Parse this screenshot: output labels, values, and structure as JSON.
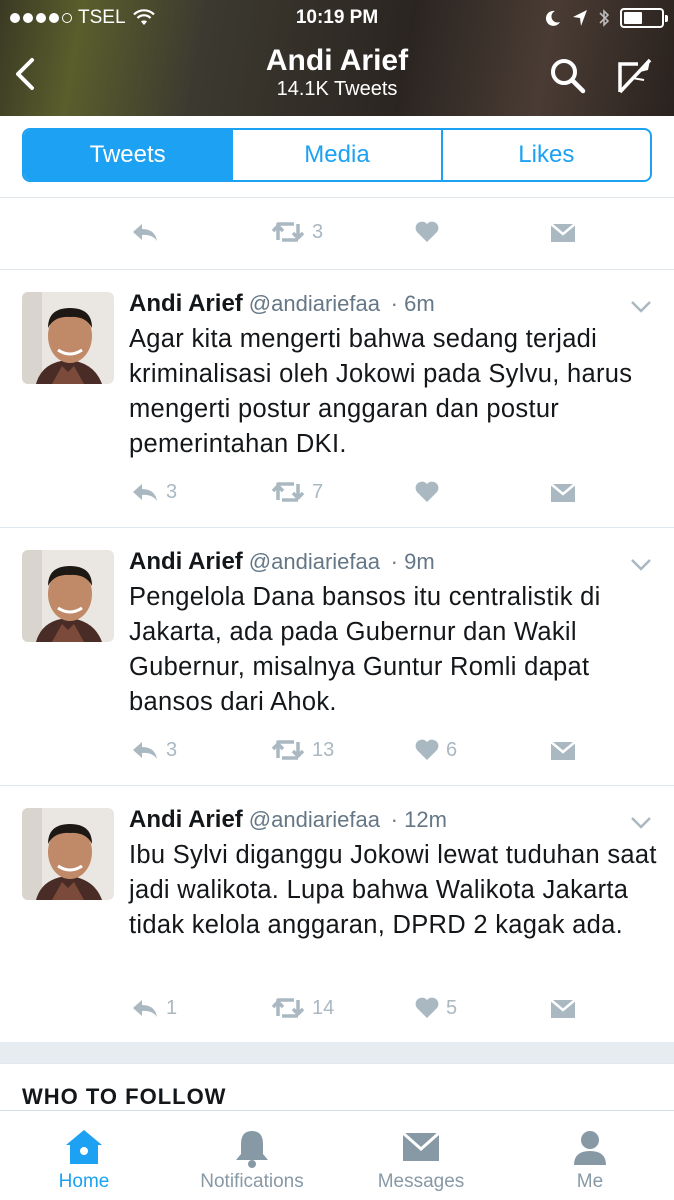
{
  "status_bar": {
    "carrier": "TSEL",
    "time": "10:19 PM"
  },
  "header": {
    "title": "Andi Arief",
    "subtitle": "14.1K Tweets"
  },
  "tabs": [
    {
      "label": "Tweets",
      "active": true
    },
    {
      "label": "Media",
      "active": false
    },
    {
      "label": "Likes",
      "active": false
    }
  ],
  "partial_tweet": {
    "reply_count": "",
    "retweet_count": "3",
    "like_count": ""
  },
  "tweets": [
    {
      "name": "Andi Arief",
      "handle": "@andiariefaa",
      "time": "· 6m",
      "text": "Agar kita mengerti bahwa sedang terjadi kriminalisasi oleh Jokowi pada Sylvu, harus mengerti postur anggaran dan postur pemerintahan DKI.",
      "reply_count": "3",
      "retweet_count": "7",
      "like_count": ""
    },
    {
      "name": "Andi Arief",
      "handle": "@andiariefaa",
      "time": "· 9m",
      "text": "Pengelola Dana bansos itu centralistik di Jakarta, ada pada Gubernur dan Wakil Gubernur, misalnya Guntur Romli dapat bansos dari Ahok.",
      "reply_count": "3",
      "retweet_count": "13",
      "like_count": "6"
    },
    {
      "name": "Andi Arief",
      "handle": "@andiariefaa",
      "time": "· 12m",
      "text": "Ibu Sylvi diganggu Jokowi lewat tuduhan saat jadi walikota. Lupa bahwa Walikota Jakarta tidak kelola anggaran, DPRD 2 kagak ada.",
      "reply_count": "1",
      "retweet_count": "14",
      "like_count": "5"
    }
  ],
  "who_to_follow": "WHO TO FOLLOW",
  "bottom_nav": [
    {
      "label": "Home",
      "icon": "home-icon",
      "active": true
    },
    {
      "label": "Notifications",
      "icon": "bell-icon",
      "active": false
    },
    {
      "label": "Messages",
      "icon": "envelope-icon",
      "active": false
    },
    {
      "label": "Me",
      "icon": "person-icon",
      "active": false
    }
  ],
  "colors": {
    "accent": "#1da1f2",
    "action_gray": "#aab8c2"
  }
}
